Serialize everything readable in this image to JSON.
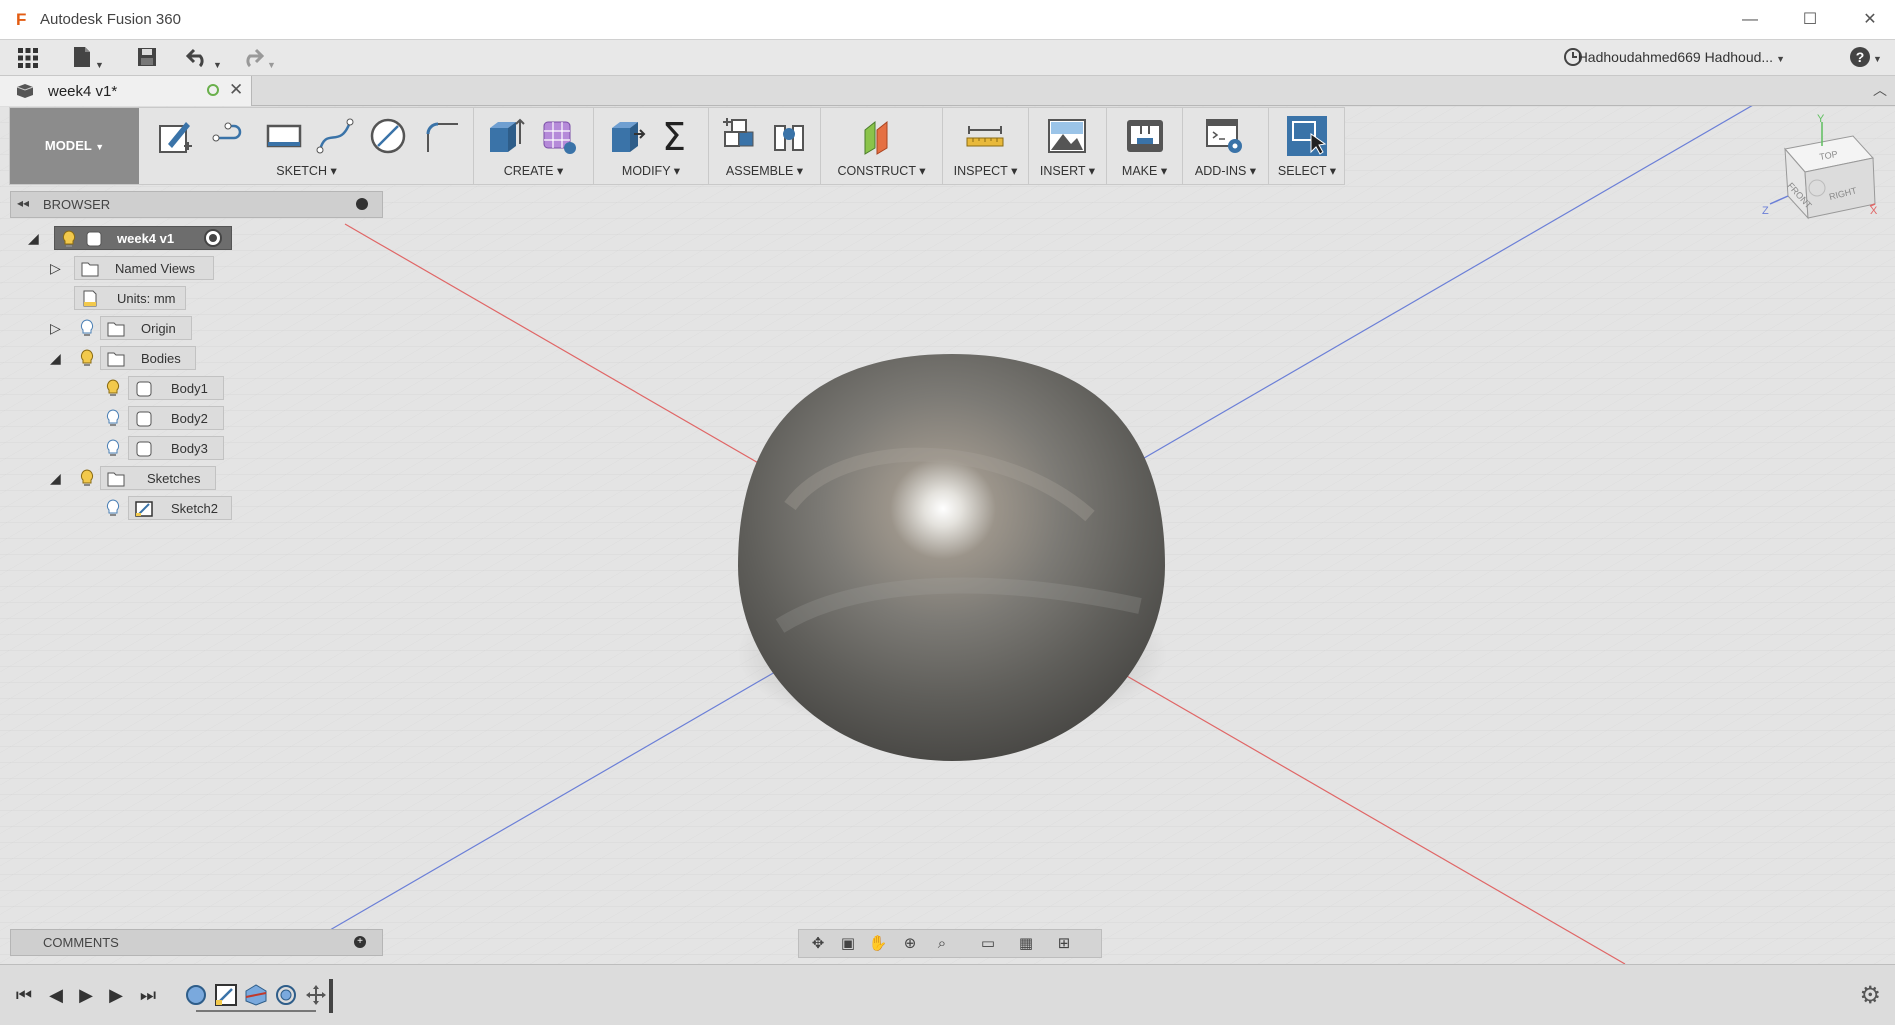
{
  "window": {
    "title": "Autodesk Fusion 360",
    "minimize": "—",
    "maximize": "☐",
    "close": "✕"
  },
  "quick_access": {
    "user_name": "Hadhoudahmed669 Hadhoud...",
    "help": "?"
  },
  "document": {
    "tab_label": "week4 v1*"
  },
  "ribbon": {
    "workspace": "MODEL",
    "groups": [
      {
        "label": "SKETCH"
      },
      {
        "label": "CREATE"
      },
      {
        "label": "MODIFY"
      },
      {
        "label": "ASSEMBLE"
      },
      {
        "label": "CONSTRUCT"
      },
      {
        "label": "INSPECT"
      },
      {
        "label": "INSERT"
      },
      {
        "label": "MAKE"
      },
      {
        "label": "ADD-INS"
      },
      {
        "label": "SELECT"
      }
    ]
  },
  "browser": {
    "title": "BROWSER",
    "root": "week4 v1",
    "items": [
      {
        "label": "Named Views"
      },
      {
        "label": "Units: mm"
      },
      {
        "label": "Origin"
      },
      {
        "label": "Bodies"
      },
      {
        "label": "Body1"
      },
      {
        "label": "Body2"
      },
      {
        "label": "Body3"
      },
      {
        "label": "Sketches"
      },
      {
        "label": "Sketch2"
      }
    ]
  },
  "comments": {
    "title": "COMMENTS"
  },
  "viewcube": {
    "top": "TOP",
    "front": "FRONT",
    "right": "RIGHT",
    "axis_x": "X",
    "axis_y": "Y",
    "axis_z": "Z"
  },
  "colors": {
    "accent": "#3a73a8",
    "workspace_bg": "#8c8c8c",
    "x_axis": "#e06666",
    "z_axis": "#6b7fd7"
  }
}
